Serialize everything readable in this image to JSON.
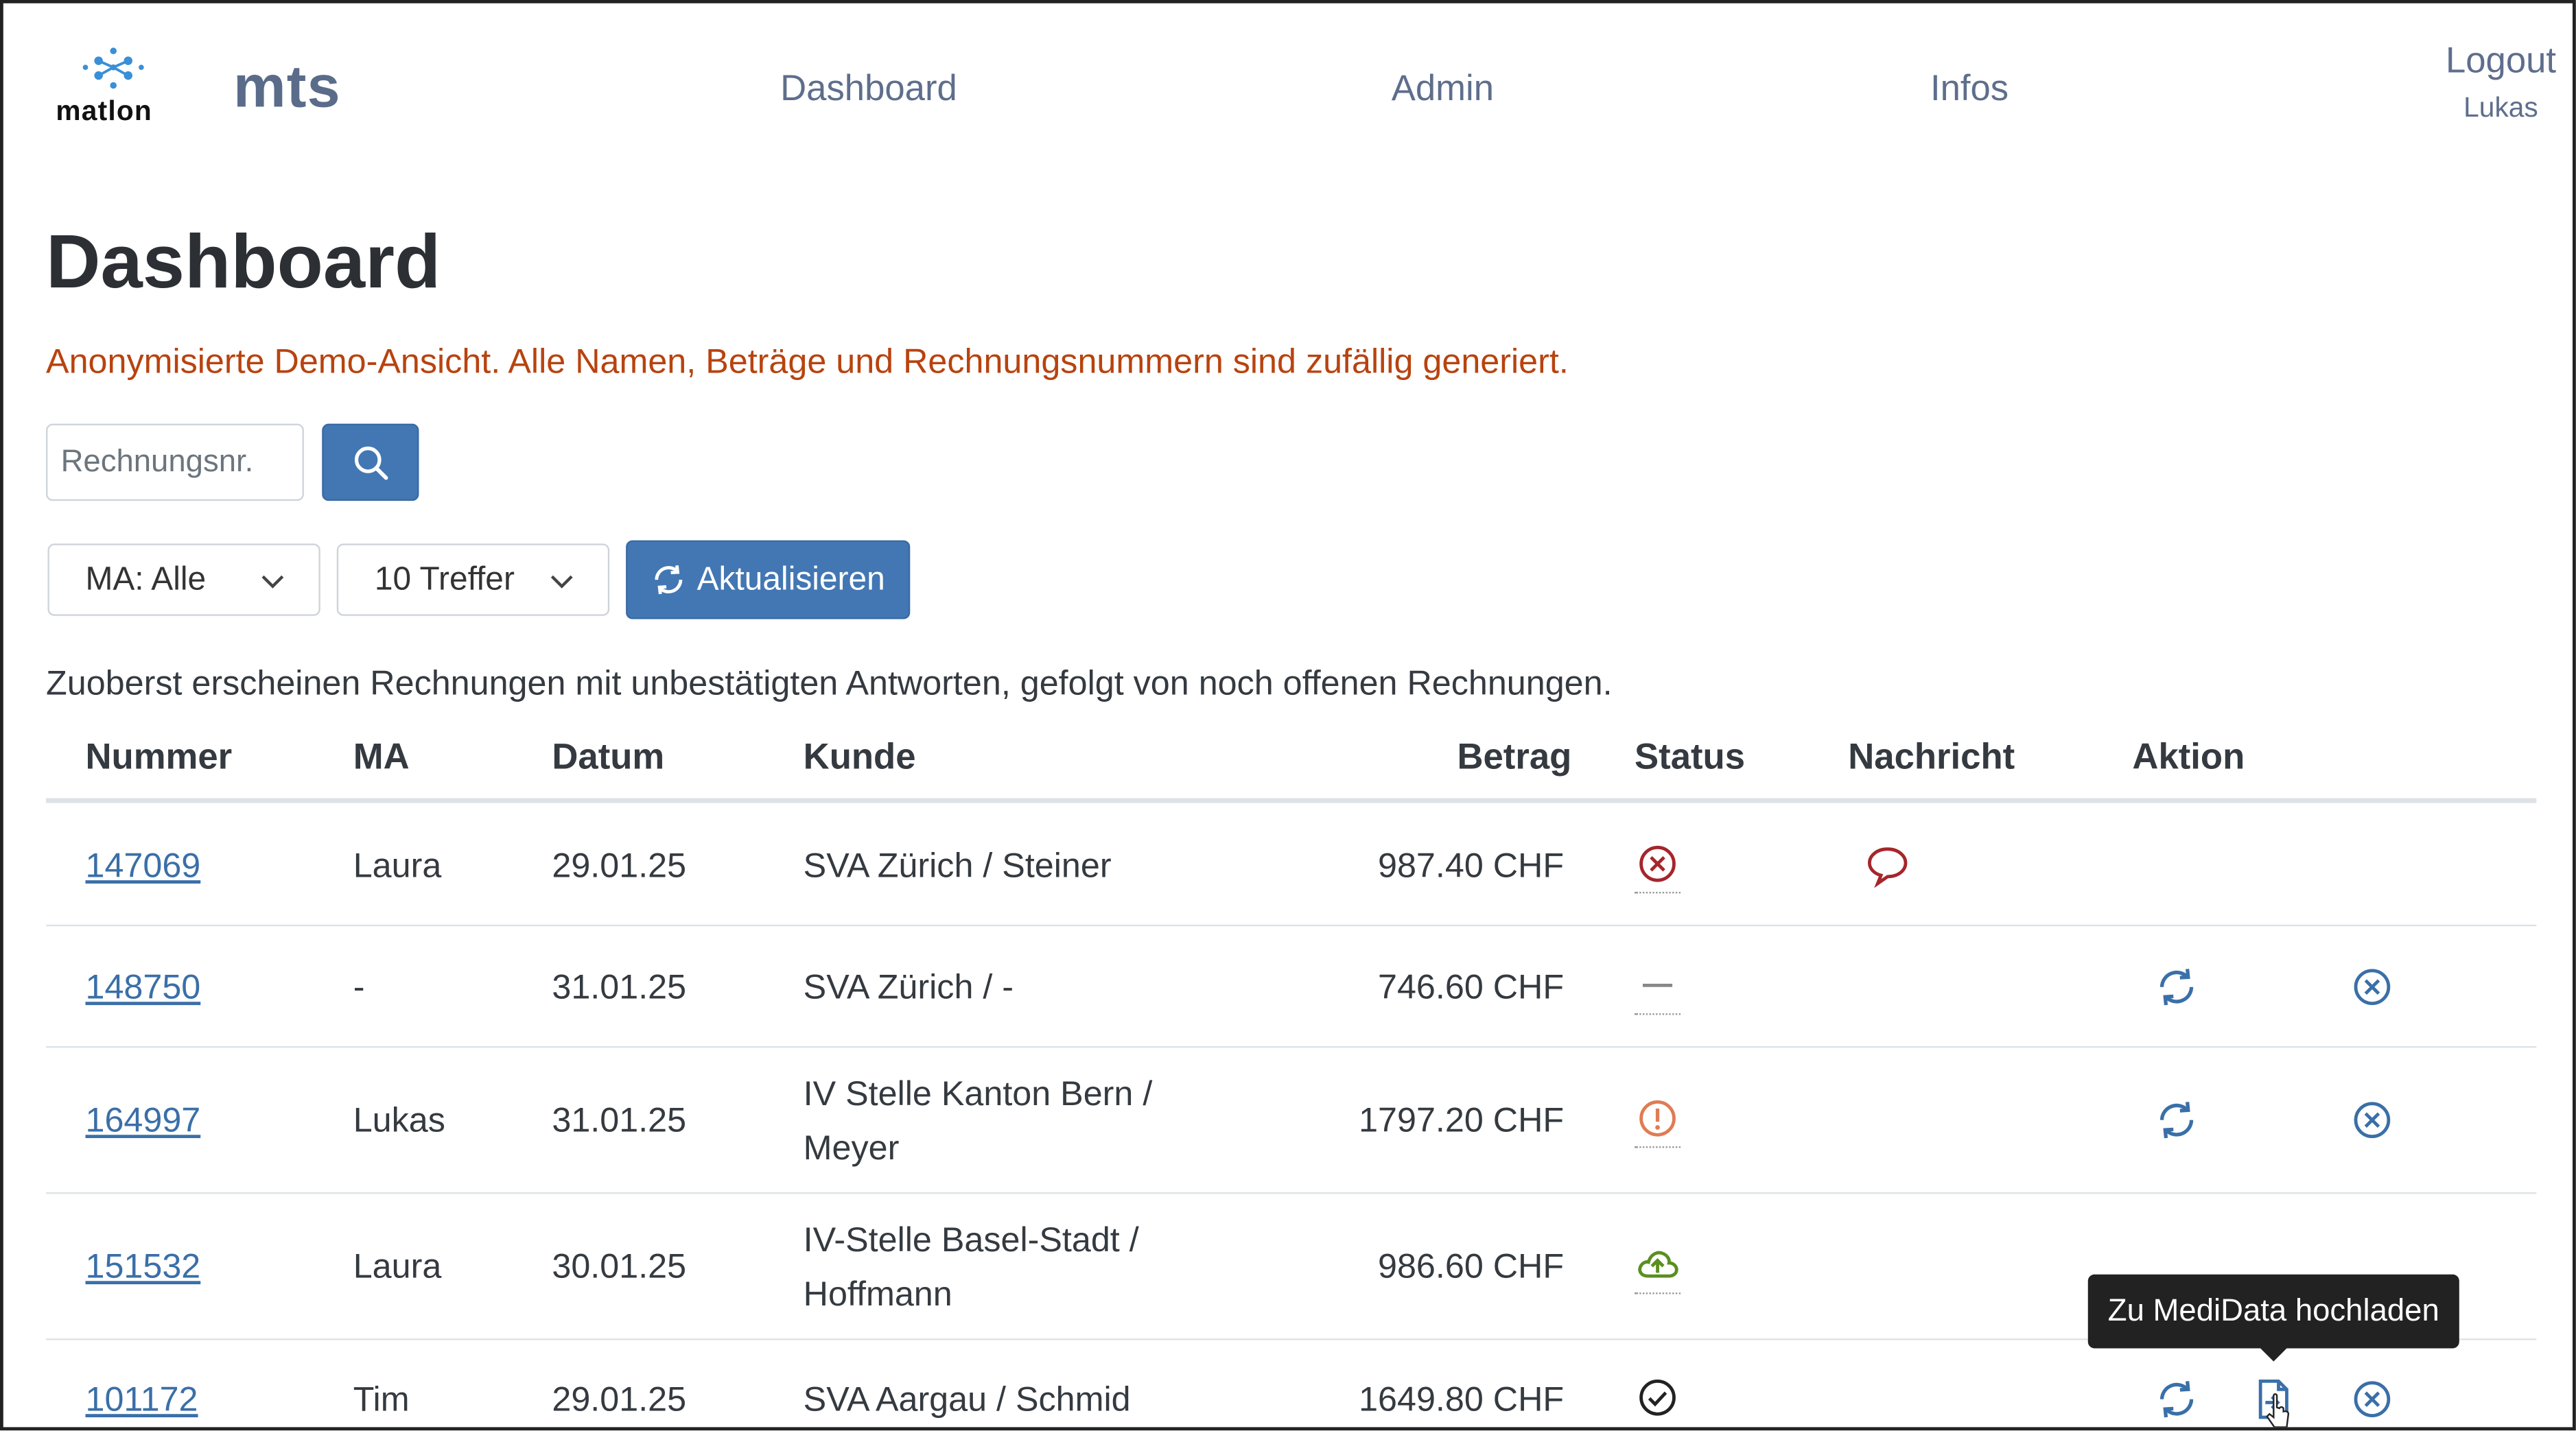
{
  "header": {
    "logo_text": "matlon",
    "brand": "mts",
    "nav": [
      "Dashboard",
      "Admin",
      "Infos"
    ],
    "logout_label": "Logout",
    "user_name": "Lukas"
  },
  "page": {
    "title": "Dashboard",
    "demo_note": "Anonymisierte Demo-Ansicht. Alle Namen, Beträge und Rechnungsnummern sind zufällig generiert.",
    "info_text": "Zuoberst erscheinen Rechnungen mit unbestätigten Antworten, gefolgt von noch offenen Rechnungen."
  },
  "search": {
    "placeholder": "Rechnungsnr."
  },
  "filters": {
    "ma_select": "MA: Alle",
    "hits_select": "10 Treffer",
    "refresh_label": "Aktualisieren"
  },
  "table": {
    "headers": [
      "Nummer",
      "MA",
      "Datum",
      "Kunde",
      "Betrag",
      "Status",
      "Nachricht",
      "Aktion"
    ],
    "rows": [
      {
        "nummer": "147069",
        "ma": "Laura",
        "datum": "29.01.25",
        "kunde": [
          "SVA Zürich / Steiner"
        ],
        "betrag": "987.40 CHF",
        "status": "error-circle-icon",
        "nachricht": true,
        "actions": []
      },
      {
        "nummer": "148750",
        "ma": "-",
        "datum": "31.01.25",
        "kunde": [
          "SVA Zürich / -"
        ],
        "betrag": "746.60 CHF",
        "status": "dash-icon",
        "nachricht": false,
        "actions": [
          "refresh",
          "cancel"
        ]
      },
      {
        "nummer": "164997",
        "ma": "Lukas",
        "datum": "31.01.25",
        "kunde": [
          "IV Stelle Kanton Bern /",
          "Meyer"
        ],
        "betrag": "1797.20 CHF",
        "status": "warning-icon",
        "nachricht": false,
        "actions": [
          "refresh",
          "cancel"
        ]
      },
      {
        "nummer": "151532",
        "ma": "Laura",
        "datum": "30.01.25",
        "kunde": [
          "IV-Stelle Basel-Stadt /",
          "Hoffmann"
        ],
        "betrag": "986.60 CHF",
        "status": "cloud-upload-icon",
        "nachricht": false,
        "actions": []
      },
      {
        "nummer": "101172",
        "ma": "Tim",
        "datum": "29.01.25",
        "kunde": [
          "SVA Aargau / Schmid"
        ],
        "betrag": "1649.80 CHF",
        "status": "check-circle-icon",
        "nachricht": false,
        "actions": [
          "refresh",
          "upload",
          "cancel"
        ]
      }
    ]
  },
  "tooltip": "Zu MediData hochladen",
  "colors": {
    "primary": "#4277b3",
    "note": "#b8430f",
    "error": "#a5262b",
    "warning": "#e07b55",
    "success": "#5a8f1f"
  }
}
